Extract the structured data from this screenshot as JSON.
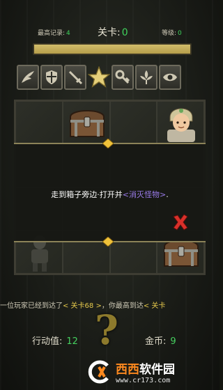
{
  "header": {
    "best_label": "最高记录:",
    "best_value": "4",
    "level_label": "关卡:",
    "level_value": "0",
    "rank_label": "等级:",
    "rank_value": "0",
    "progress": 1.0
  },
  "tools": [
    "wing-icon",
    "shield-icon",
    "sword-icon",
    "star-icon",
    "key-icon",
    "fleur-icon",
    "eye-icon"
  ],
  "dialog": {
    "text_before": "走到箱子旁边·打开并",
    "text_highlight": "<消灭怪物>",
    "text_after": "."
  },
  "ticker": {
    "text1": "一位玩家已经到达了",
    "level1": "< 关卡68 >",
    "text2": "，你最高到达",
    "level2": "< 关卡"
  },
  "bottom": {
    "steps_label": "行动值:",
    "steps_value": "12",
    "coins_label": "金币:",
    "coins_value": "9"
  },
  "watermark": {
    "brand_orange": "西西",
    "brand_white": "软件园",
    "url": "www.cr173.com"
  },
  "colors": {
    "accent_green": "#3fd35c",
    "highlight_purple": "#9a7bea",
    "highlight_gold": "#e5c84b",
    "close_red": "#d8302a"
  }
}
